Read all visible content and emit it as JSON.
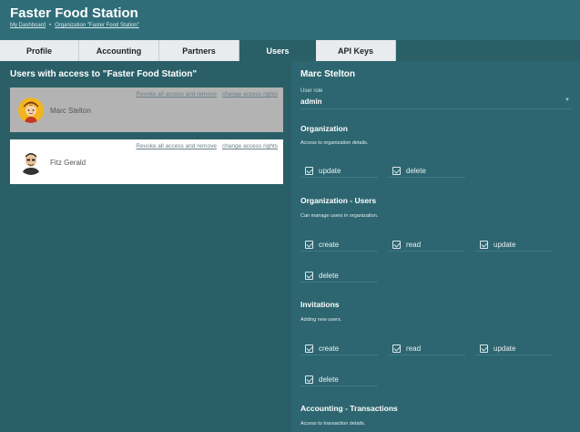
{
  "app": {
    "title": "Faster Food Station"
  },
  "breadcrumb": {
    "items": [
      "My Dashboard",
      "Organization \"Faster Food Station\""
    ],
    "separator": "•"
  },
  "tabs": [
    {
      "label": "Profile",
      "active": false
    },
    {
      "label": "Accounting",
      "active": false
    },
    {
      "label": "Partners",
      "active": false
    },
    {
      "label": "Users",
      "active": true
    },
    {
      "label": "API Keys",
      "active": false
    }
  ],
  "users_panel": {
    "heading": "Users with access to \"Faster Food Station\"",
    "users": [
      {
        "name": "Marc Stelton",
        "selected": true,
        "revoke_label": "Revoke all access and remove",
        "change_label": "change access rights",
        "avatar_icon": "cartoon-avatar-icon"
      },
      {
        "name": "Fitz Gerald",
        "selected": false,
        "revoke_label": "Revoke all access and remove",
        "change_label": "change access rights",
        "avatar_icon": "person-avatar-icon"
      }
    ]
  },
  "detail": {
    "name": "Marc Stelton",
    "role_label": "User role",
    "role_value": "admin",
    "sections": [
      {
        "title": "Organization",
        "description": "Access to organization details.",
        "permissions": [
          "update",
          "delete"
        ]
      },
      {
        "title": "Organization - Users",
        "description": "Can manage users in organization.",
        "permissions": [
          "create",
          "read",
          "update",
          "delete"
        ]
      },
      {
        "title": "Invitations",
        "description": "Adding new users.",
        "permissions": [
          "create",
          "read",
          "update",
          "delete"
        ]
      },
      {
        "title": "Accounting - Transactions",
        "description": "Access to transaction details.",
        "permissions": []
      }
    ]
  },
  "colors": {
    "background": "#2d6670",
    "header": "#2f6e79",
    "tab_inactive": "#e8ecee",
    "selected_card": "#b3b3b3"
  }
}
